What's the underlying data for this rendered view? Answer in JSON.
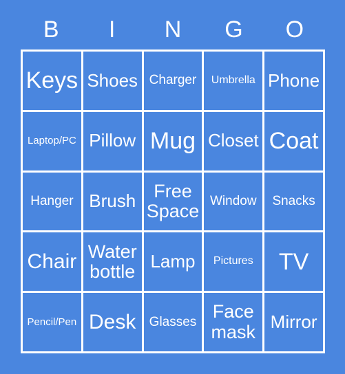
{
  "card": {
    "title": "BINGO Card",
    "background_color": "#4a86df",
    "line_color": "#ffffff",
    "text_color": "#ffffff"
  },
  "header": {
    "letters": [
      "B",
      "I",
      "N",
      "G",
      "O"
    ]
  },
  "grid": {
    "columns": 5,
    "rows": 5,
    "free_space_index": 12,
    "cells": [
      {
        "label": "Keys",
        "size": "sz-xl"
      },
      {
        "label": "Shoes",
        "size": "sz-md"
      },
      {
        "label": "Charger",
        "size": "sz-sm"
      },
      {
        "label": "Umbrella",
        "size": "sz-xs"
      },
      {
        "label": "Phone",
        "size": "sz-md"
      },
      {
        "label": "Laptop/PC",
        "size": "sz-xxs"
      },
      {
        "label": "Pillow",
        "size": "sz-md"
      },
      {
        "label": "Mug",
        "size": "sz-xl"
      },
      {
        "label": "Closet",
        "size": "sz-md"
      },
      {
        "label": "Coat",
        "size": "sz-xl"
      },
      {
        "label": "Hanger",
        "size": "sz-sm"
      },
      {
        "label": "Brush",
        "size": "sz-md"
      },
      {
        "label": "Free\nSpace",
        "size": "sz-wrap-lg"
      },
      {
        "label": "Window",
        "size": "sz-sm"
      },
      {
        "label": "Snacks",
        "size": "sz-sm"
      },
      {
        "label": "Chair",
        "size": "sz-lg"
      },
      {
        "label": "Water\nbottle",
        "size": "sz-wrap-lg"
      },
      {
        "label": "Lamp",
        "size": "sz-md"
      },
      {
        "label": "Pictures",
        "size": "sz-xs"
      },
      {
        "label": "TV",
        "size": "sz-xl"
      },
      {
        "label": "Pencil/Pen",
        "size": "sz-xxs"
      },
      {
        "label": "Desk",
        "size": "sz-lg"
      },
      {
        "label": "Glasses",
        "size": "sz-sm"
      },
      {
        "label": "Face\nmask",
        "size": "sz-wrap-lg"
      },
      {
        "label": "Mirror",
        "size": "sz-md"
      }
    ]
  }
}
